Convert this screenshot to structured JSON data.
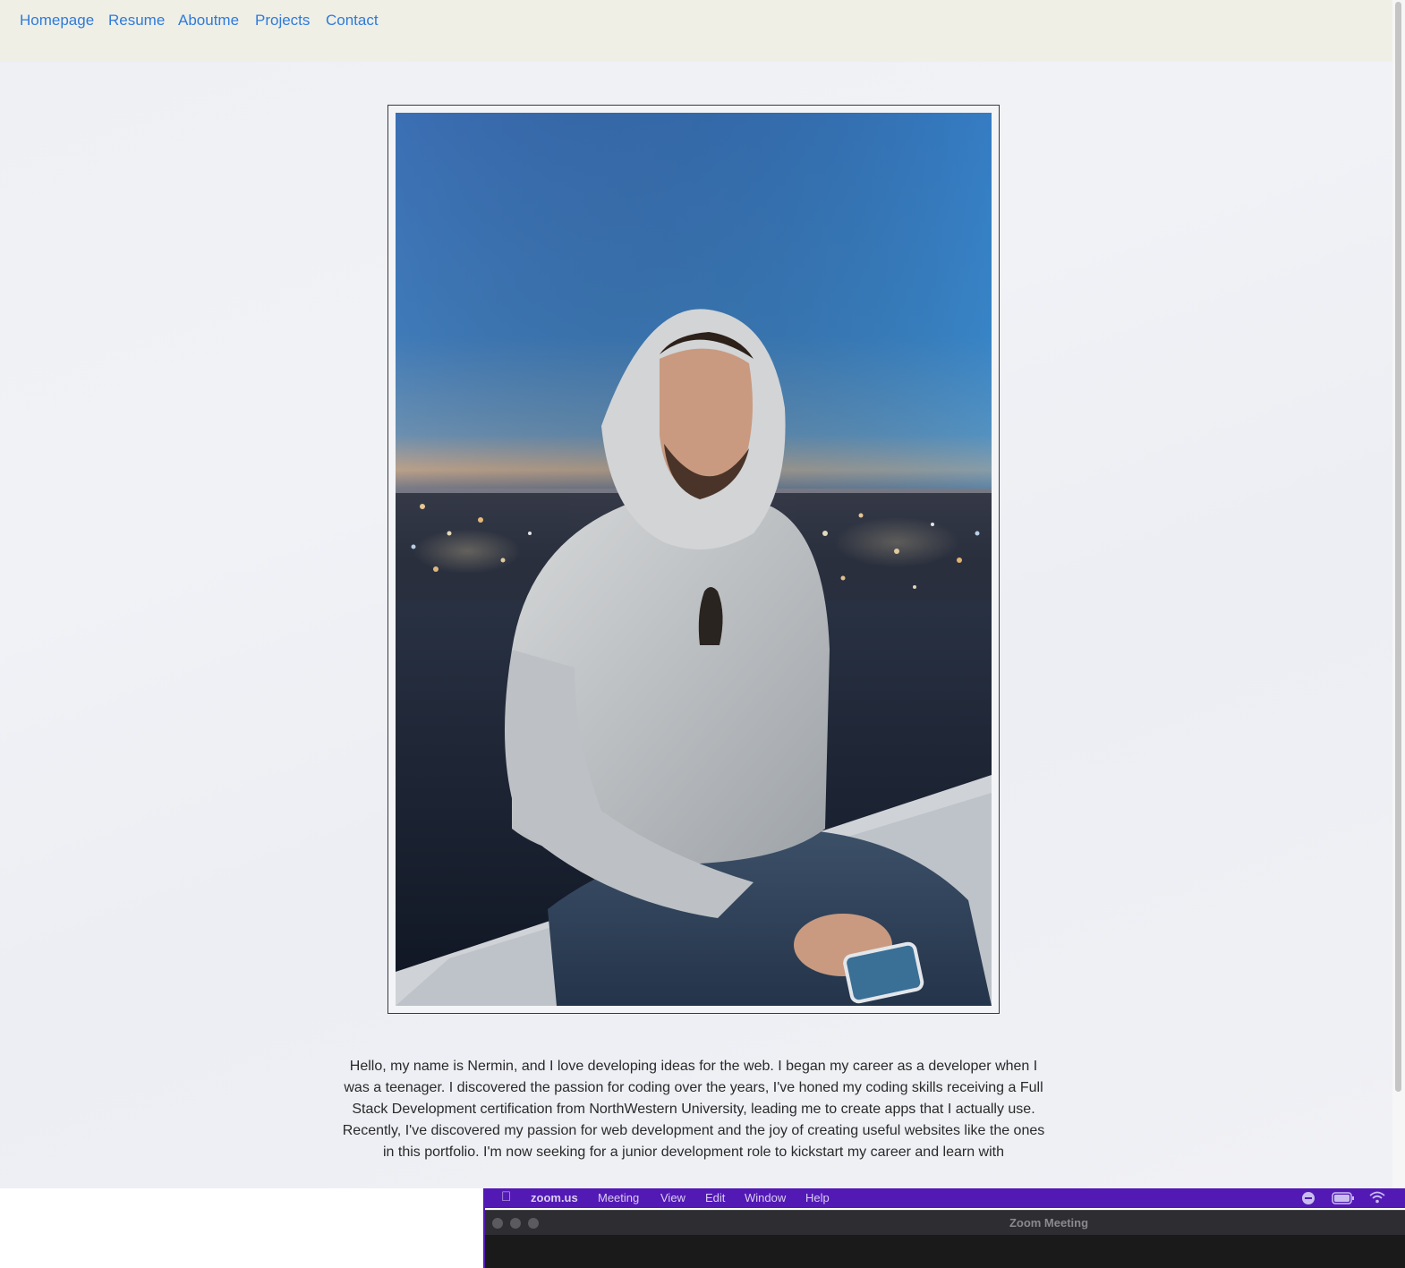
{
  "navbar": {
    "links": [
      "Homepage",
      "Resume",
      "Aboutme",
      "Projects",
      "Contact"
    ]
  },
  "bio": {
    "paragraph1": "Hello, my name is Nermin, and I love developing ideas for the web. I began my career as a developer when I was a teenager. I discovered the passion for coding over the years, I've honed my coding skills receiving a Full Stack Development certification from NorthWestern University, leading me to create apps that I actually use.",
    "paragraph2": "Recently, I've discovered my passion for web development and the joy of creating useful websites like the ones in this portfolio. I'm now seeking for a junior development role to kickstart my career and learn with"
  },
  "zoom_menubar": {
    "app": "zoom.us",
    "items": [
      "Meeting",
      "View",
      "Edit",
      "Window",
      "Help"
    ],
    "icons": [
      "apple-icon",
      "do-not-disturb-icon",
      "battery-icon",
      "wifi-icon"
    ]
  },
  "zoom_window": {
    "title": "Zoom Meeting"
  },
  "colors": {
    "nav_link": "#2f7bd9",
    "navbar_bg": "#efefe6",
    "zoom_menubar": "#5319b5"
  }
}
